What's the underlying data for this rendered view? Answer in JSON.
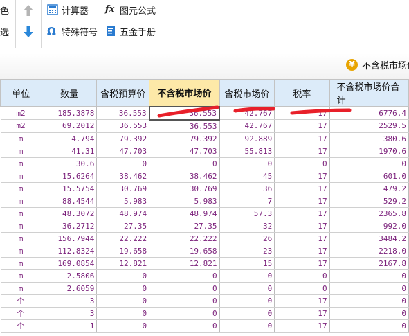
{
  "toolbar": {
    "fragment1": "色",
    "fragment2": "选",
    "calc_label": "计算器",
    "formula_label": "图元公式",
    "special_label": "特殊符号",
    "hardware_label": "五金手册"
  },
  "info": {
    "label": "不含税市场价"
  },
  "columns": [
    "单位",
    "数量",
    "含税预算价",
    "不含税市场价",
    "含税市场价",
    "税率",
    "不含税市场价合计"
  ],
  "rows": [
    [
      "m2",
      "185.3878",
      "36.553",
      "36.553",
      "42.767",
      "17",
      "6776.4"
    ],
    [
      "m2",
      "69.2012",
      "36.553",
      "36.553",
      "42.767",
      "17",
      "2529.5"
    ],
    [
      "m",
      "4.794",
      "79.392",
      "79.392",
      "92.889",
      "17",
      "380.6"
    ],
    [
      "m",
      "41.31",
      "47.703",
      "47.703",
      "55.813",
      "17",
      "1970.6"
    ],
    [
      "m",
      "30.6",
      "0",
      "0",
      "0",
      "0",
      "0"
    ],
    [
      "m",
      "15.6264",
      "38.462",
      "38.462",
      "45",
      "17",
      "601.0"
    ],
    [
      "m",
      "15.5754",
      "30.769",
      "30.769",
      "36",
      "17",
      "479.2"
    ],
    [
      "m",
      "88.4544",
      "5.983",
      "5.983",
      "7",
      "17",
      "529.2"
    ],
    [
      "m",
      "48.3072",
      "48.974",
      "48.974",
      "57.3",
      "17",
      "2365.8"
    ],
    [
      "m",
      "36.2712",
      "27.35",
      "27.35",
      "32",
      "17",
      "992.0"
    ],
    [
      "m",
      "156.7944",
      "22.222",
      "22.222",
      "26",
      "17",
      "3484.2"
    ],
    [
      "m",
      "112.8324",
      "19.658",
      "19.658",
      "23",
      "17",
      "2218.0"
    ],
    [
      "m",
      "169.0854",
      "12.821",
      "12.821",
      "15",
      "17",
      "2167.8"
    ],
    [
      "m",
      "2.5806",
      "0",
      "0",
      "0",
      "0",
      "0"
    ],
    [
      "m",
      "2.6059",
      "0",
      "0",
      "0",
      "0",
      "0"
    ],
    [
      "个",
      "3",
      "0",
      "0",
      "0",
      "17",
      "0"
    ],
    [
      "个",
      "3",
      "0",
      "0",
      "0",
      "17",
      "0"
    ],
    [
      "个",
      "1",
      "0",
      "0",
      "0",
      "17",
      "0"
    ]
  ],
  "colors": {
    "header_bg": "#dcebf9",
    "active_header_bg": "#fde9a8",
    "cell_text": "#7a1f7a",
    "annotation": "#e8202a"
  }
}
